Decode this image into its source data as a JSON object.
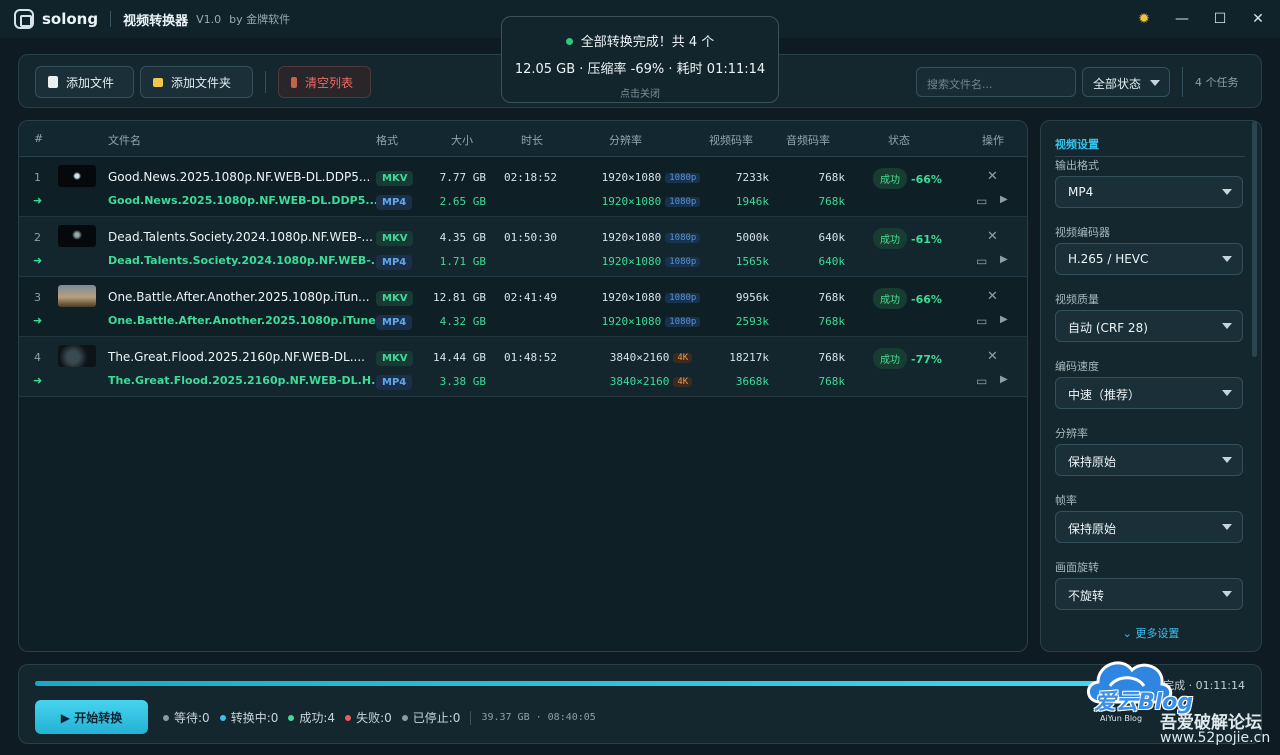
{
  "titlebar": {
    "brand": "solong",
    "app_title": "视频转换器",
    "version": "V1.0",
    "by": "by 金牌软件"
  },
  "toast": {
    "line1": "全部转换完成！共 4 个",
    "line2": "12.05 GB · 压缩率 -69% · 耗时 01:11:14",
    "line3": "点击关闭"
  },
  "toolbar": {
    "add_file": "添加文件",
    "add_folder": "添加文件夹",
    "clear_list": "清空列表",
    "search_placeholder": "搜索文件名...",
    "status_filter": "全部状态",
    "task_count": "4 个任务"
  },
  "table": {
    "headers": {
      "idx": "#",
      "name": "文件名",
      "format": "格式",
      "size": "大小",
      "duration": "时长",
      "resolution": "分辨率",
      "vbitrate": "视频码率",
      "abitrate": "音频码率",
      "status": "状态",
      "actions": "操作"
    },
    "rows": [
      {
        "idx": "1",
        "name": "Good.News.2025.1080p.NF.WEB-DL.DDP5...",
        "format": "MKV",
        "size": "7.77 GB",
        "duration": "02:18:52",
        "resolution": "1920×1080",
        "res_tag": "1080p",
        "vbitrate": "7233k",
        "abitrate": "768k",
        "status": "成功",
        "ratio": "-66%",
        "out": {
          "arrow": "➜",
          "name": "Good.News.2025.1080p.NF.WEB-DL.DDP5....",
          "format": "MP4",
          "size": "2.65 GB",
          "resolution": "1920×1080",
          "res_tag": "1080p",
          "vbitrate": "1946k",
          "abitrate": "768k"
        }
      },
      {
        "idx": "2",
        "name": "Dead.Talents.Society.2024.1080p.NF.WEB-...",
        "format": "MKV",
        "size": "4.35 GB",
        "duration": "01:50:30",
        "resolution": "1920×1080",
        "res_tag": "1080p",
        "vbitrate": "5000k",
        "abitrate": "640k",
        "status": "成功",
        "ratio": "-61%",
        "out": {
          "arrow": "➜",
          "name": "Dead.Talents.Society.2024.1080p.NF.WEB-...",
          "format": "MP4",
          "size": "1.71 GB",
          "resolution": "1920×1080",
          "res_tag": "1080p",
          "vbitrate": "1565k",
          "abitrate": "640k"
        }
      },
      {
        "idx": "3",
        "name": "One.Battle.After.Another.2025.1080p.iTun...",
        "format": "MKV",
        "size": "12.81 GB",
        "duration": "02:41:49",
        "resolution": "1920×1080",
        "res_tag": "1080p",
        "vbitrate": "9956k",
        "abitrate": "768k",
        "status": "成功",
        "ratio": "-66%",
        "out": {
          "arrow": "➜",
          "name": "One.Battle.After.Another.2025.1080p.iTune...",
          "format": "MP4",
          "size": "4.32 GB",
          "resolution": "1920×1080",
          "res_tag": "1080p",
          "vbitrate": "2593k",
          "abitrate": "768k"
        }
      },
      {
        "idx": "4",
        "name": "The.Great.Flood.2025.2160p.NF.WEB-DL....",
        "format": "MKV",
        "size": "14.44 GB",
        "duration": "01:48:52",
        "resolution": "3840×2160",
        "res_tag": "4K",
        "vbitrate": "18217k",
        "abitrate": "768k",
        "status": "成功",
        "ratio": "-77%",
        "out": {
          "arrow": "➜",
          "name": "The.Great.Flood.2025.2160p.NF.WEB-DL.H...",
          "format": "MP4",
          "size": "3.38 GB",
          "resolution": "3840×2160",
          "res_tag": "4K",
          "vbitrate": "3668k",
          "abitrate": "768k"
        }
      }
    ]
  },
  "settings": {
    "section": "视频设置",
    "fields": [
      {
        "label": "输出格式",
        "value": "MP4"
      },
      {
        "label": "视频编码器",
        "value": "H.265 / HEVC"
      },
      {
        "label": "视频质量",
        "value": "自动 (CRF 28)"
      },
      {
        "label": "编码速度",
        "value": "中速（推荐）"
      },
      {
        "label": "分辨率",
        "value": "保持原始"
      },
      {
        "label": "帧率",
        "value": "保持原始"
      },
      {
        "label": "画面旋转",
        "value": "不旋转"
      }
    ],
    "more": "⌄ 更多设置"
  },
  "bottom": {
    "progress": 1.0,
    "progress_info": "4/4 · 已完成 · 01:11:14",
    "start": "▶ 开始转换",
    "stats": {
      "waiting": "等待:0",
      "converting": "转换中:0",
      "success": "成功:4",
      "failed": "失败:0",
      "stopped": "已停止:0"
    },
    "total": "39.37 GB · 08:40:05"
  },
  "watermark": {
    "big": "爱云Blog",
    "small": "AiYun Blog",
    "cn": "吾爱破解论坛",
    "url": "www.52pojie.cn"
  },
  "colors": {
    "accent": "#35c3ec",
    "success": "#3ddc97",
    "failed": "#ef5a5a",
    "bg": "#0f1b22"
  }
}
